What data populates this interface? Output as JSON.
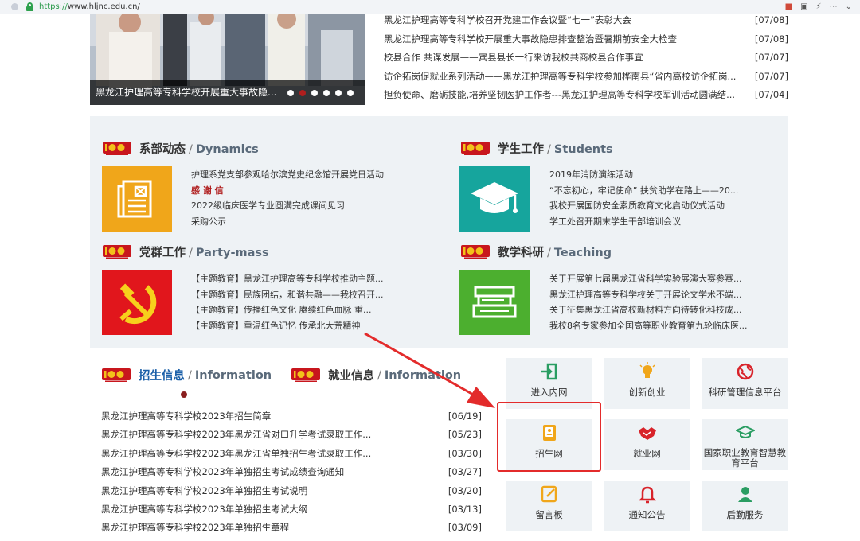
{
  "browser": {
    "url_scheme": "https://",
    "url_rest": "www.hljnc.edu.cn/"
  },
  "slider": {
    "caption": "黑龙江护理高等专科学校开展重大事故隐...",
    "dot_count": 6,
    "active_dot": 1
  },
  "news": [
    {
      "title": "黑龙江护理高等专科学校召开党建工作会议暨“七一”表彰大会",
      "date": "[07/08]"
    },
    {
      "title": "黑龙江护理高等专科学校开展重大事故隐患排查整治暨暑期前安全大检查",
      "date": "[07/08]"
    },
    {
      "title": "校县合作 共谋发展——宾县县长一行来访我校共商校县合作事宜",
      "date": "[07/07]"
    },
    {
      "title": "访企拓岗促就业系列活动——黑龙江护理高等专科学校参加桦南县“省内高校访企拓岗...",
      "date": "[07/07]"
    },
    {
      "title": "担负使命、磨砺技能,培养坚韧医护工作者---黑龙江护理高等专科学校军训活动圆满结...",
      "date": "[07/04]"
    }
  ],
  "sections": {
    "dynamics": {
      "zh": "系部动态",
      "en": "Dynamics",
      "items": [
        "护理系党支部参观哈尔滨党史纪念馆开展党日活动",
        "感 谢 信",
        "2022级临床医学专业圆满完成课间见习",
        "采购公示"
      ]
    },
    "students": {
      "zh": "学生工作",
      "en": "Students",
      "items": [
        "2019年消防演练活动",
        "“不忘初心，牢记使命” 扶贫助学在路上——20...",
        "我校开展国防安全素质教育文化启动仪式活动",
        "学工处召开期末学生干部培训会议"
      ]
    },
    "party": {
      "zh": "党群工作",
      "en": "Party-mass",
      "items": [
        "【主题教育】黑龙江护理高等专科学校推动主题...",
        "【主题教育】民族团结，和谐共融——我校召开...",
        "【主题教育】传播红色文化 赓续红色血脉 重...",
        "【主题教育】重温红色记忆 传承北大荒精神"
      ]
    },
    "teaching": {
      "zh": "教学科研",
      "en": "Teaching",
      "items": [
        "关于开展第七届黑龙江省科学实验展演大赛参赛...",
        "黑龙江护理高等专科学校关于开展论文学术不端...",
        "关于征集黑龙江省高校新材料方向待转化科技成...",
        "我校8名专家参加全国高等职业教育第九轮临床医..."
      ]
    }
  },
  "bottom": {
    "head1_zh": "招生信息",
    "head1_en": "Information",
    "head2_zh": "就业信息",
    "head2_en": "Information",
    "list": [
      {
        "title": "黑龙江护理高等专科学校2023年招生简章",
        "date": "[06/19]"
      },
      {
        "title": "黑龙江护理高等专科学校2023年黑龙江省对口升学考试录取工作...",
        "date": "[05/23]"
      },
      {
        "title": "黑龙江护理高等专科学校2023年黑龙江省单独招生考试录取工作...",
        "date": "[03/30]"
      },
      {
        "title": "黑龙江护理高等专科学校2023年单独招生考试成绩查询通知",
        "date": "[03/27]"
      },
      {
        "title": "黑龙江护理高等专科学校2023年单独招生考试说明",
        "date": "[03/20]"
      },
      {
        "title": "黑龙江护理高等专科学校2023年单独招生考试大纲",
        "date": "[03/13]"
      },
      {
        "title": "黑龙江护理高等专科学校2023年单独招生章程",
        "date": "[03/09]"
      }
    ]
  },
  "tiles": {
    "intranet": "进入内网",
    "innovation": "创新创业",
    "research": "科研管理信息平台",
    "admissions": "招生网",
    "employment": "就业网",
    "smart_edu_1": "国家职业教育智慧教",
    "smart_edu_2": "育平台",
    "message": "留言板",
    "notice": "通知公告",
    "logistics": "后勤服务"
  },
  "colors": {
    "accent_red": "#b01e1e",
    "link_blue": "#1a5fa8",
    "tile_green": "#2a9d62",
    "tile_gold": "#f0a61a",
    "highlight": "#e32b2b"
  }
}
